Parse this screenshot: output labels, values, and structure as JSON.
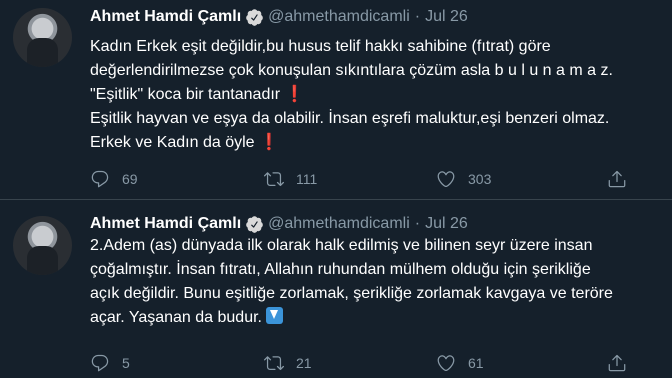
{
  "tweets": [
    {
      "author_name": "Ahmet Hamdi Çamlı",
      "handle": "@ahmethamdicamli",
      "date": "Jul 26",
      "lines": [
        "Kadın Erkek eşit değildir,bu husus telif hakkı sahibine (fıtrat) göre",
        "değerlendirilmezse çok konuşulan sıkıntılara çözüm asla b u l u n a m a z.",
        "\"Eşitlik\" koca bir tantanadır",
        "Eşitlik hayvan ve eşya da olabilir. İnsan eşrefi maluktur,eşi benzeri olmaz.",
        "Erkek ve Kadın da öyle"
      ],
      "emoji": "❗",
      "replies": "69",
      "retweets": "111",
      "likes": "303"
    },
    {
      "author_name": "Ahmet Hamdi Çamlı",
      "handle": "@ahmethamdicamli",
      "date": "Jul 26",
      "lines": [
        "2.Adem (as) dünyada ilk olarak halk edilmiş ve bilinen seyr üzere insan",
        "çoğalmıştır. İnsan fıtratı, Allahın ruhundan mülhem olduğu için şerikliğe",
        "açık değildir. Bunu eşitliğe zorlamak, şerikliğe zorlamak kavgaya ve teröre",
        "açar. Yaşanan da budur."
      ],
      "emoji": "⬇️",
      "replies": "5",
      "retweets": "21",
      "likes": "61"
    }
  ],
  "icons": {
    "reply": "reply-icon",
    "retweet": "retweet-icon",
    "like": "like-icon",
    "share": "share-icon",
    "verified": "verified-badge-icon"
  },
  "colors": {
    "background": "#15202b",
    "secondary_text": "#8899a6",
    "verified": "#1da1f2",
    "emoji_red": "#e0245e"
  }
}
